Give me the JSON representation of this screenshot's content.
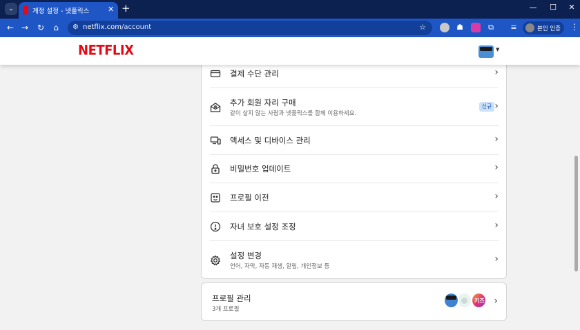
{
  "browser": {
    "tab_title": "계정 설정 - 넷플릭스",
    "tab_close": "✕",
    "new_tab": "+",
    "url_host": "netflix.com",
    "url_path": "/account",
    "profile_label": "본인 인증",
    "window_controls": [
      "—",
      "☐",
      "✕"
    ]
  },
  "header": {
    "logo": "NETFLIX"
  },
  "menu": {
    "items": [
      {
        "label": "결제 수단 관리",
        "icon": "credit-card-icon",
        "sub": ""
      },
      {
        "label": "추가 회원 자리 구매",
        "icon": "envelope-person-icon",
        "sub": "같이 살지 않는 사람과 넷플릭스를 함께 이용하세요.",
        "badge": "신규"
      },
      {
        "label": "액세스 및 디바이스 관리",
        "icon": "devices-icon",
        "sub": ""
      },
      {
        "label": "비밀번호 업데이트",
        "icon": "lock-icon",
        "sub": ""
      },
      {
        "label": "프로필 이전",
        "icon": "profile-transfer-icon",
        "sub": ""
      },
      {
        "label": "자녀 보호 설정 조정",
        "icon": "alert-circle-icon",
        "sub": ""
      },
      {
        "label": "설정 변경",
        "icon": "gear-icon",
        "sub": "언어, 자막, 자동 재생, 알림, 개인정보 등"
      }
    ]
  },
  "profiles": {
    "title": "프로필 관리",
    "count": "3개 프로필",
    "kids_label": "키즈"
  },
  "colors": {
    "brand": "#e50914",
    "chrome_dark": "#0c2150",
    "chrome_bar": "#1f56c6",
    "badge_bg": "#cde0f7",
    "badge_text": "#1b5fb5"
  }
}
